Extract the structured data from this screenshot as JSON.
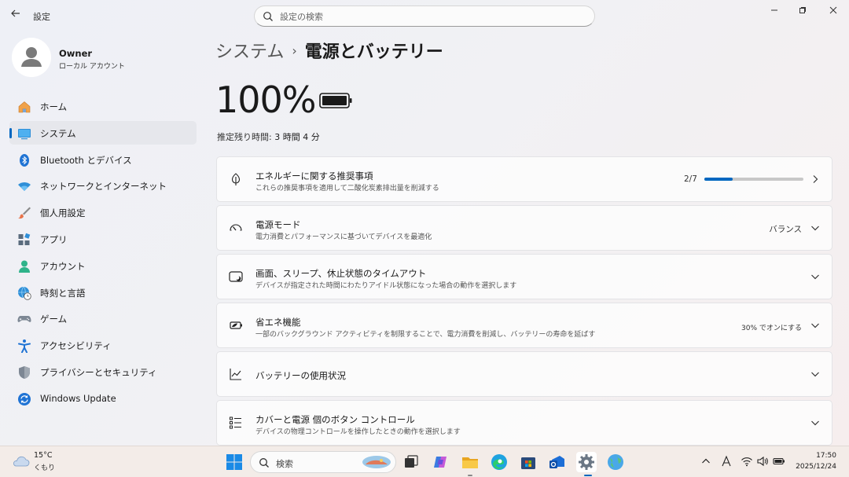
{
  "app": {
    "title": "設定",
    "back_icon": "back-arrow-icon"
  },
  "search": {
    "placeholder": "設定の検索",
    "value": ""
  },
  "window_controls": {
    "minimize": "minimize-icon",
    "maximize": "maximize-icon",
    "close": "close-icon"
  },
  "profile": {
    "name": "Owner",
    "account_type": "ローカル アカウント"
  },
  "sidebar": {
    "items": [
      {
        "label": "ホーム",
        "icon": "home-icon",
        "active": false
      },
      {
        "label": "システム",
        "icon": "system-icon",
        "active": true
      },
      {
        "label": "Bluetooth とデバイス",
        "icon": "bluetooth-icon",
        "active": false
      },
      {
        "label": "ネットワークとインターネット",
        "icon": "wifi-icon",
        "active": false
      },
      {
        "label": "個人用設定",
        "icon": "brush-icon",
        "active": false
      },
      {
        "label": "アプリ",
        "icon": "apps-icon",
        "active": false
      },
      {
        "label": "アカウント",
        "icon": "account-icon",
        "active": false
      },
      {
        "label": "時刻と言語",
        "icon": "globe-clock-icon",
        "active": false
      },
      {
        "label": "ゲーム",
        "icon": "gamepad-icon",
        "active": false
      },
      {
        "label": "アクセシビリティ",
        "icon": "accessibility-icon",
        "active": false
      },
      {
        "label": "プライバシーとセキュリティ",
        "icon": "shield-icon",
        "active": false
      },
      {
        "label": "Windows Update",
        "icon": "windows-update-icon",
        "active": false
      }
    ]
  },
  "main": {
    "breadcrumb": {
      "parent": "システム",
      "separator": "›",
      "current": "電源とバッテリー"
    },
    "battery": {
      "percent": "100%",
      "remaining_label": "推定残り時間:",
      "remaining_value": "3 時間 4 分"
    },
    "cards": [
      {
        "title": "エネルギーに関する推奨事項",
        "desc": "これらの推奨事項を適用して二酸化炭素排出量を削減する",
        "icon": "leaf-icon",
        "progress_label": "2/7",
        "progress_fraction": 0.2857,
        "chevron": "right"
      },
      {
        "title": "電源モード",
        "desc": "電力消費とパフォーマンスに基づいてデバイスを最適化",
        "icon": "speedometer-icon",
        "value": "バランス",
        "chevron": "down"
      },
      {
        "title": "画面、スリープ、休止状態のタイムアウト",
        "desc": "デバイスが指定された時間にわたりアイドル状態になった場合の動作を選択します",
        "icon": "screen-sleep-icon",
        "chevron": "down"
      },
      {
        "title": "省エネ機能",
        "desc": "一部のバックグラウンド アクティビティを制限することで、電力消費を削減し、バッテリーの寿命を延ばす",
        "icon": "battery-saver-icon",
        "value": "30% でオンにする",
        "chevron": "down"
      },
      {
        "title": "バッテリーの使用状況",
        "desc": "",
        "icon": "chart-icon",
        "chevron": "down"
      },
      {
        "title": "カバーと電源 個のボタン コントロール",
        "desc": "デバイスの物理コントロールを操作したときの動作を選択します",
        "icon": "button-controls-icon",
        "chevron": "down"
      }
    ]
  },
  "taskbar": {
    "weather": {
      "temp": "15°C",
      "condition": "くもり",
      "icon": "cloud-icon"
    },
    "search_label": "検索",
    "clock": {
      "time": "17:50",
      "date": "2025/12/24"
    }
  },
  "colors": {
    "accent": "#0067c0",
    "taskbar": "#f3ece8"
  }
}
